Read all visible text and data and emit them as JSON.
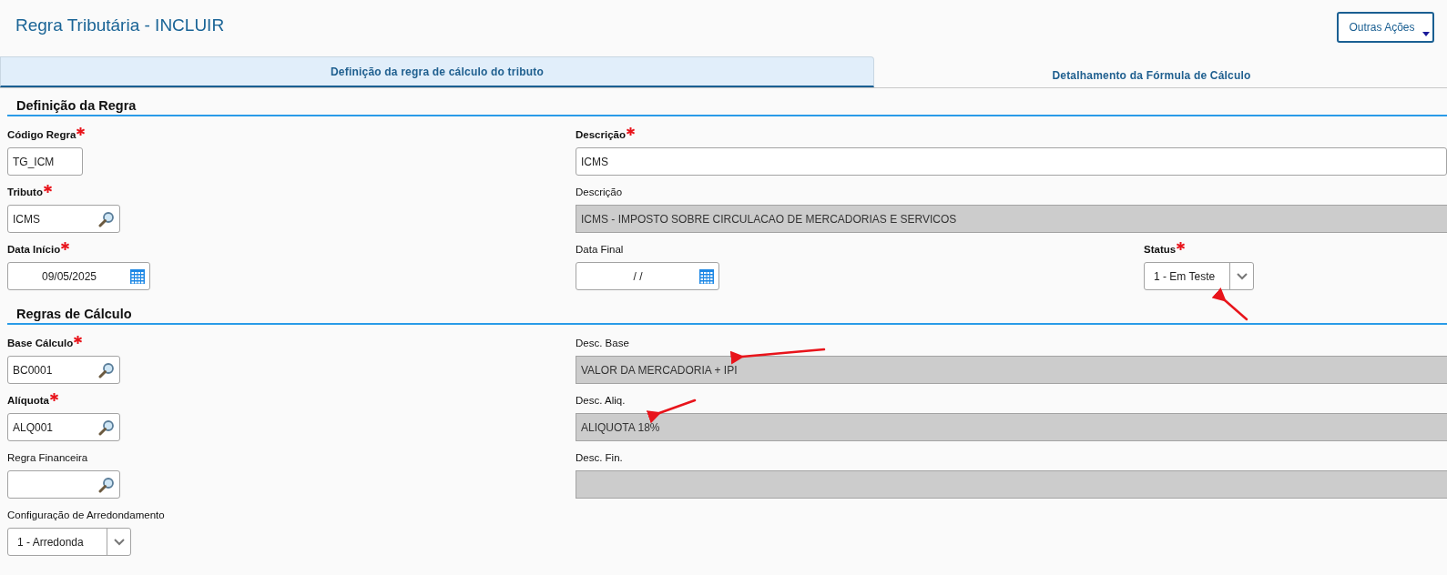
{
  "title": "Regra Tributária - INCLUIR",
  "actions_button": {
    "label": "Outras Ações"
  },
  "tabs": [
    {
      "label": "Definição da regra de cálculo do tributo",
      "selected": true
    },
    {
      "label": "Detalhamento da Fórmula de Cálculo",
      "selected": false
    }
  ],
  "sections": [
    {
      "title": "Definição da Regra",
      "rows": [
        [
          {
            "label": "Código Regra",
            "required": true,
            "kind": "text",
            "value": "TG_ICM"
          },
          {
            "label": "Descrição",
            "required": true,
            "kind": "text",
            "value": "ICMS"
          }
        ],
        [
          {
            "label": "Tributo",
            "required": true,
            "kind": "lookup",
            "value": "ICMS"
          },
          {
            "label": "Descrição",
            "required": false,
            "kind": "readonly",
            "value": "ICMS - IMPOSTO SOBRE CIRCULACAO DE MERCADORIAS E SERVICOS"
          }
        ],
        [
          {
            "label": "Data Início",
            "required": true,
            "kind": "date",
            "value": "09/05/2025"
          },
          {
            "label": "Data Final",
            "required": false,
            "kind": "date",
            "value": "/  /"
          },
          {
            "label": "Status",
            "required": true,
            "kind": "select",
            "value": "1 - Em Teste"
          }
        ]
      ]
    },
    {
      "title": "Regras de Cálculo",
      "rows": [
        [
          {
            "label": "Base Cálculo",
            "required": true,
            "kind": "lookup",
            "value": "BC0001"
          },
          {
            "label": "Desc. Base",
            "required": false,
            "kind": "readonly",
            "value": "VALOR DA MERCADORIA + IPI"
          }
        ],
        [
          {
            "label": "Alíquota",
            "required": true,
            "kind": "lookup",
            "value": "ALQ001"
          },
          {
            "label": "Desc. Aliq.",
            "required": false,
            "kind": "readonly",
            "value": "ALIQUOTA 18%"
          }
        ],
        [
          {
            "label": "Regra Financeira",
            "required": false,
            "kind": "lookup"
          },
          {
            "label": "Desc. Fin.",
            "required": false,
            "kind": "readonly"
          }
        ],
        [
          {
            "label": "Configuração de Arredondamento",
            "required": false,
            "kind": "select",
            "value": "1 - Arredonda"
          }
        ]
      ]
    }
  ]
}
